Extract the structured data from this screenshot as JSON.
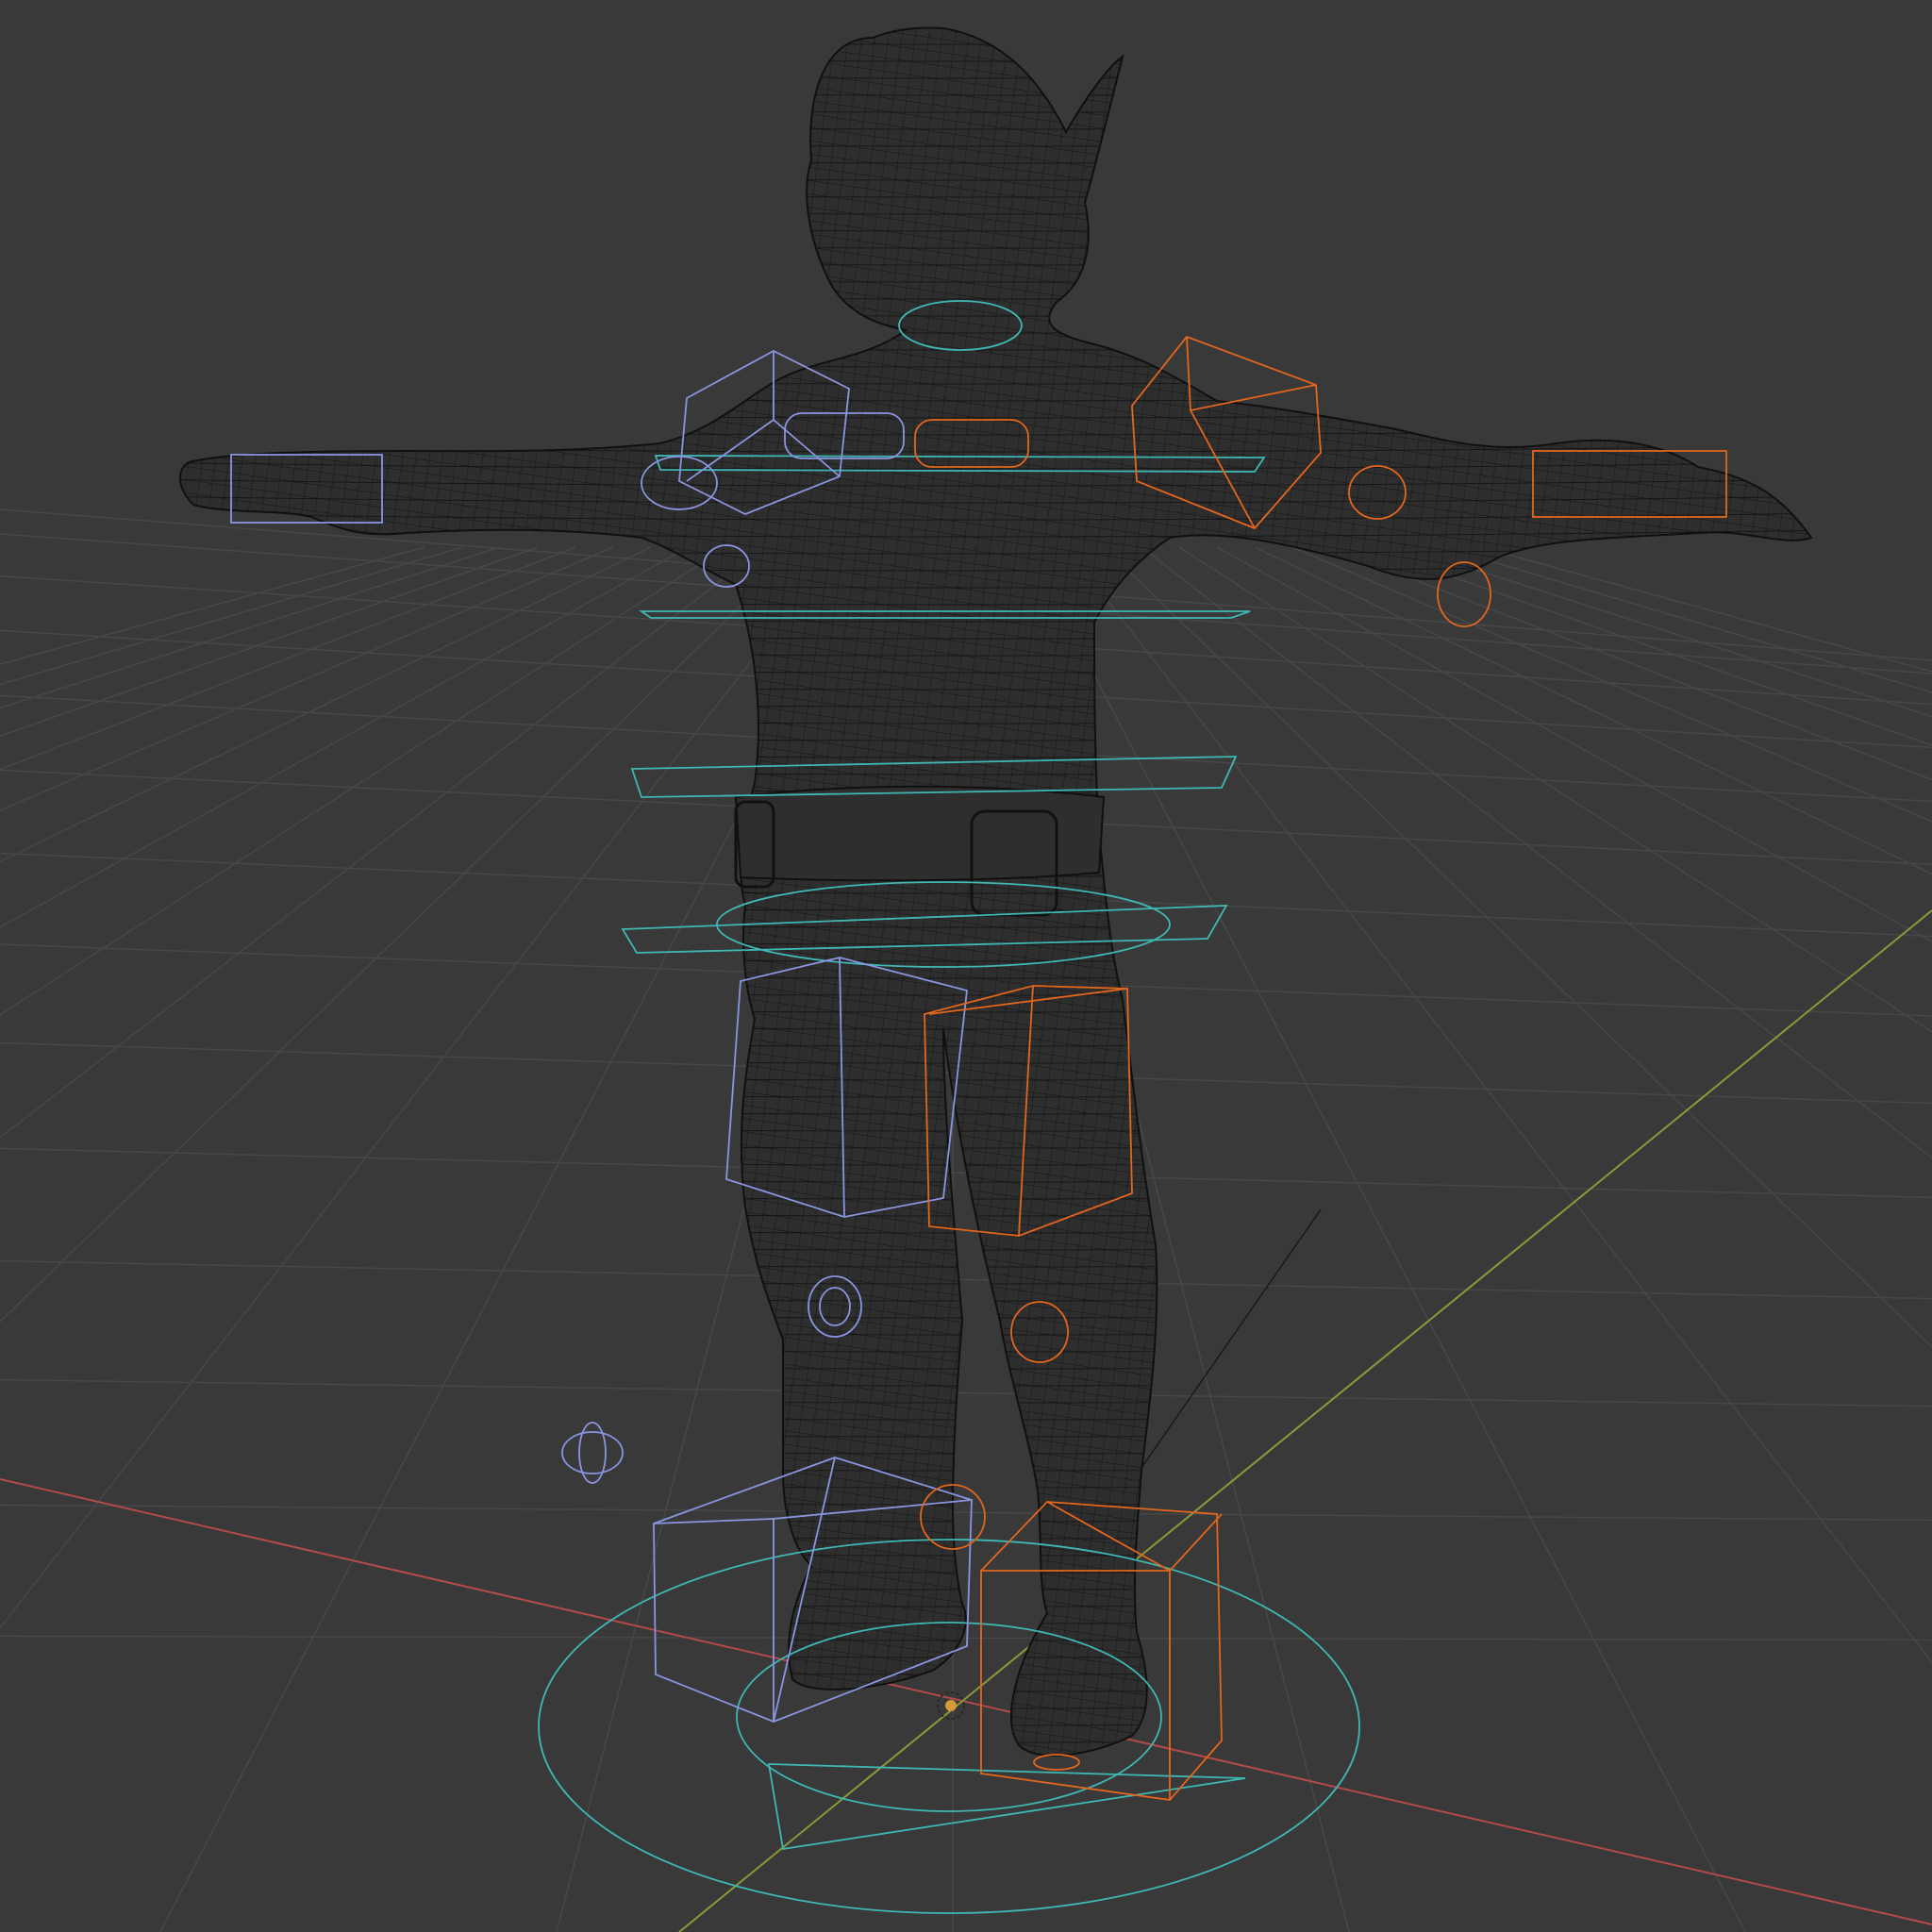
{
  "viewport": {
    "editor": "3D Viewport",
    "shading": "wireframe",
    "background": "#393939",
    "grid_color": "#474747",
    "x_axis_color": "#b34b4b",
    "y_axis_color": "#8a9a3a",
    "mesh_wire_color": "#0d0d0d"
  },
  "rig": {
    "left_control_color": "#8a95e0",
    "right_control_color": "#e2661d",
    "center_control_color": "#3fb8b4",
    "icons": [
      "character-mesh-icon",
      "rig-controls-icon",
      "origin-icon"
    ]
  }
}
